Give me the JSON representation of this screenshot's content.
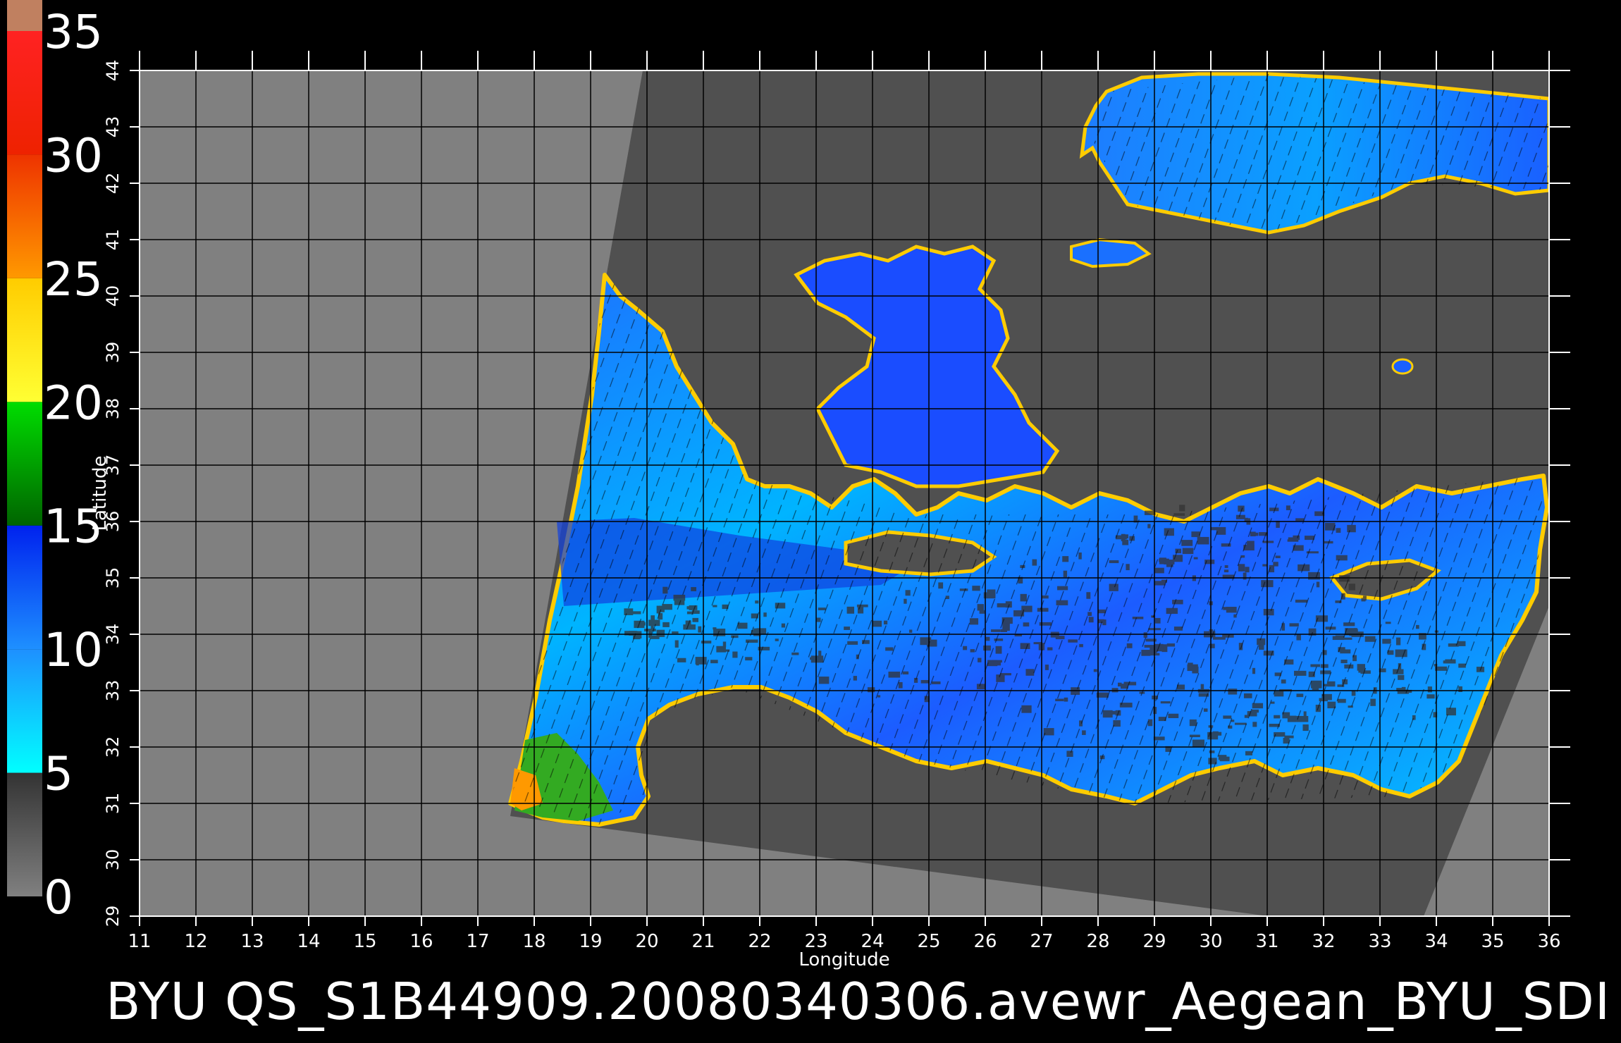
{
  "title": "BYU QS_S1B44909.20080340306.avewr_Aegean_BYU_SDI",
  "x_axis": {
    "label": "Longitude",
    "ticks": [
      "11",
      "12",
      "13",
      "14",
      "15",
      "16",
      "17",
      "18",
      "19",
      "20",
      "21",
      "22",
      "23",
      "24",
      "25",
      "26",
      "27",
      "28",
      "29",
      "30",
      "31",
      "32",
      "33",
      "34",
      "35",
      "36"
    ],
    "range": [
      11,
      36
    ]
  },
  "y_axis": {
    "label": "Latitude",
    "ticks": [
      "29",
      "30",
      "31",
      "32",
      "33",
      "34",
      "35",
      "36",
      "37",
      "38",
      "39",
      "40",
      "41",
      "42",
      "43",
      "44"
    ],
    "range": [
      29,
      44
    ]
  },
  "colorbar": {
    "labels": [
      "0",
      "5",
      "10",
      "15",
      "20",
      "25",
      "30",
      "35"
    ],
    "range": [
      0,
      35
    ],
    "segments": [
      {
        "from": 0,
        "to": 5,
        "color_low": "#808080",
        "color_high": "#333333"
      },
      {
        "from": 5,
        "to": 10,
        "color_low": "#00ffff",
        "color_high": "#1e90ff"
      },
      {
        "from": 10,
        "to": 15,
        "color_low": "#1e90ff",
        "color_high": "#0022ee"
      },
      {
        "from": 15,
        "to": 20,
        "color_low": "#006400",
        "color_high": "#00dd00"
      },
      {
        "from": 20,
        "to": 25,
        "color_low": "#ffff33",
        "color_high": "#ffcc00"
      },
      {
        "from": 25,
        "to": 30,
        "color_low": "#ff9900",
        "color_high": "#ee3300"
      },
      {
        "from": 30,
        "to": 35,
        "color_low": "#ee2200",
        "color_high": "#ff2222"
      },
      {
        "from": 35,
        "to": 36,
        "color_low": "#c08060",
        "color_high": "#c08060"
      }
    ]
  },
  "colors": {
    "background": "#000000",
    "no_data": "#808080",
    "land": "#505050",
    "grid": "#000000",
    "ocean_low": "#00ccff",
    "ocean_mid": "#1e6fff",
    "ocean_high": "#0033cc"
  }
}
